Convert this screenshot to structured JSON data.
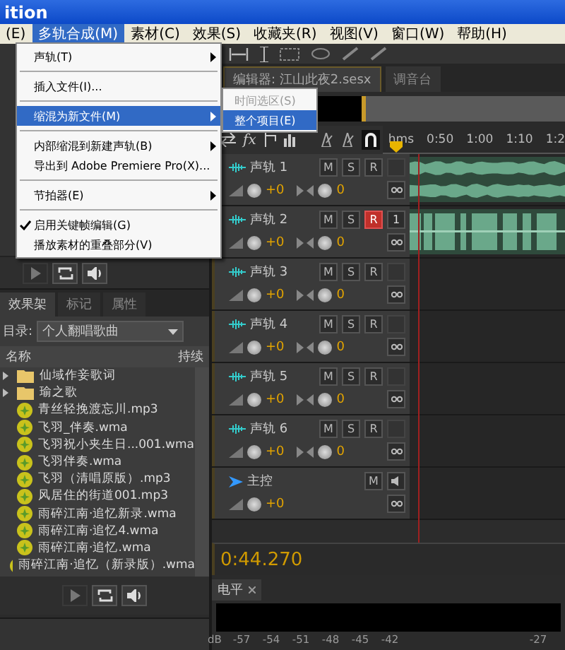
{
  "window": {
    "title": "ition"
  },
  "menubar": [
    {
      "label": "(E)",
      "selected": false
    },
    {
      "label": "多轨合成(M)",
      "selected": true
    },
    {
      "label": "素材(C)",
      "selected": false
    },
    {
      "label": "效果(S)",
      "selected": false
    },
    {
      "label": "收藏夹(R)",
      "selected": false
    },
    {
      "label": "视图(V)",
      "selected": false
    },
    {
      "label": "窗口(W)",
      "selected": false
    },
    {
      "label": "帮助(H)",
      "selected": false
    }
  ],
  "menu": {
    "groups": [
      [
        {
          "label": "声轨(T)",
          "submenu": true,
          "selected": false,
          "checked": false
        }
      ],
      [
        {
          "label": "插入文件(I)...",
          "submenu": false,
          "selected": false,
          "checked": false
        }
      ],
      [
        {
          "label": "缩混为新文件(M)",
          "submenu": true,
          "selected": true,
          "checked": false
        }
      ],
      [
        {
          "label": "内部缩混到新建声轨(B)",
          "submenu": true,
          "selected": false,
          "checked": false
        },
        {
          "label": "导出到 Adobe Premiere Pro(X)...",
          "submenu": false,
          "selected": false,
          "checked": false
        }
      ],
      [
        {
          "label": "节拍器(E)",
          "submenu": true,
          "selected": false,
          "checked": false
        }
      ],
      [
        {
          "label": "启用关键帧编辑(G)",
          "submenu": false,
          "selected": false,
          "checked": true
        },
        {
          "label": "播放素材的重叠部分(V)",
          "submenu": false,
          "selected": false,
          "checked": false
        }
      ]
    ]
  },
  "submenu": [
    {
      "label": "时间选区(S)",
      "disabled": true,
      "selected": false
    },
    {
      "label": "整个项目(E)",
      "disabled": false,
      "selected": true
    }
  ],
  "editor_tabs": [
    {
      "label": "编辑器: 江山此夜2.sesx",
      "selected": true
    },
    {
      "label": "调音台",
      "selected": false
    }
  ],
  "track_controls": {
    "effects_label": "fx"
  },
  "ruler": [
    "hms",
    "0:50",
    "1:00",
    "1:10",
    "1:2"
  ],
  "tracks": [
    {
      "name": "声轨 1",
      "mute_label": "M",
      "solo_label": "S",
      "record_label": "R",
      "volume": "+0",
      "pan": "0",
      "record": false,
      "kind": "wave"
    },
    {
      "name": "声轨 2",
      "mute_label": "M",
      "solo_label": "S",
      "record_label": "R",
      "volume": "+0",
      "pan": "0",
      "record": true,
      "input": "1",
      "kind": "blocks"
    },
    {
      "name": "声轨 3",
      "mute_label": "M",
      "solo_label": "S",
      "record_label": "R",
      "volume": "+0",
      "pan": "0",
      "record": false,
      "kind": "empty"
    },
    {
      "name": "声轨 4",
      "mute_label": "M",
      "solo_label": "S",
      "record_label": "R",
      "volume": "+0",
      "pan": "0",
      "record": false,
      "kind": "empty"
    },
    {
      "name": "声轨 5",
      "mute_label": "M",
      "solo_label": "S",
      "record_label": "R",
      "volume": "+0",
      "pan": "0",
      "record": false,
      "kind": "empty"
    },
    {
      "name": "声轨 6",
      "mute_label": "M",
      "solo_label": "S",
      "record_label": "R",
      "volume": "+0",
      "pan": "0",
      "record": false,
      "kind": "empty"
    }
  ],
  "master": {
    "name": "主控",
    "mute_label": "M",
    "volume": "+0"
  },
  "time": "0:44.270",
  "files_panel": {
    "tabs": [
      {
        "label": "效果架",
        "selected": true
      },
      {
        "label": "标记",
        "selected": false
      },
      {
        "label": "属性",
        "selected": false
      }
    ],
    "directory_label": "目录:",
    "directory": "个人翻唱歌曲",
    "columns": [
      "名称",
      "持续"
    ],
    "files": [
      {
        "kind": "folder",
        "name": "仙域作妾歌词"
      },
      {
        "kind": "folder",
        "name": "瑜之歌"
      },
      {
        "kind": "audio",
        "name": "青丝轻挽渡忘川.mp3"
      },
      {
        "kind": "audio",
        "name": "飞羽_伴奏.wma"
      },
      {
        "kind": "audio",
        "name": "飞羽祝小夹生日...001.wma"
      },
      {
        "kind": "audio",
        "name": "飞羽伴奏.wma"
      },
      {
        "kind": "audio",
        "name": "飞羽（清唱原版）.mp3"
      },
      {
        "kind": "audio",
        "name": "风居住的街道001.mp3"
      },
      {
        "kind": "audio",
        "name": "雨碎江南·追忆新录.wma"
      },
      {
        "kind": "audio",
        "name": "雨碎江南·追忆4.wma"
      },
      {
        "kind": "audio",
        "name": "雨碎江南·追忆.wma"
      },
      {
        "kind": "audio",
        "name": "雨碎江南·追忆（新录版）.wma"
      }
    ]
  },
  "meter": {
    "title": "电平",
    "scale": [
      "dB",
      "-57",
      "-54",
      "-51",
      "-48",
      "-45",
      "-42",
      "-27"
    ]
  }
}
